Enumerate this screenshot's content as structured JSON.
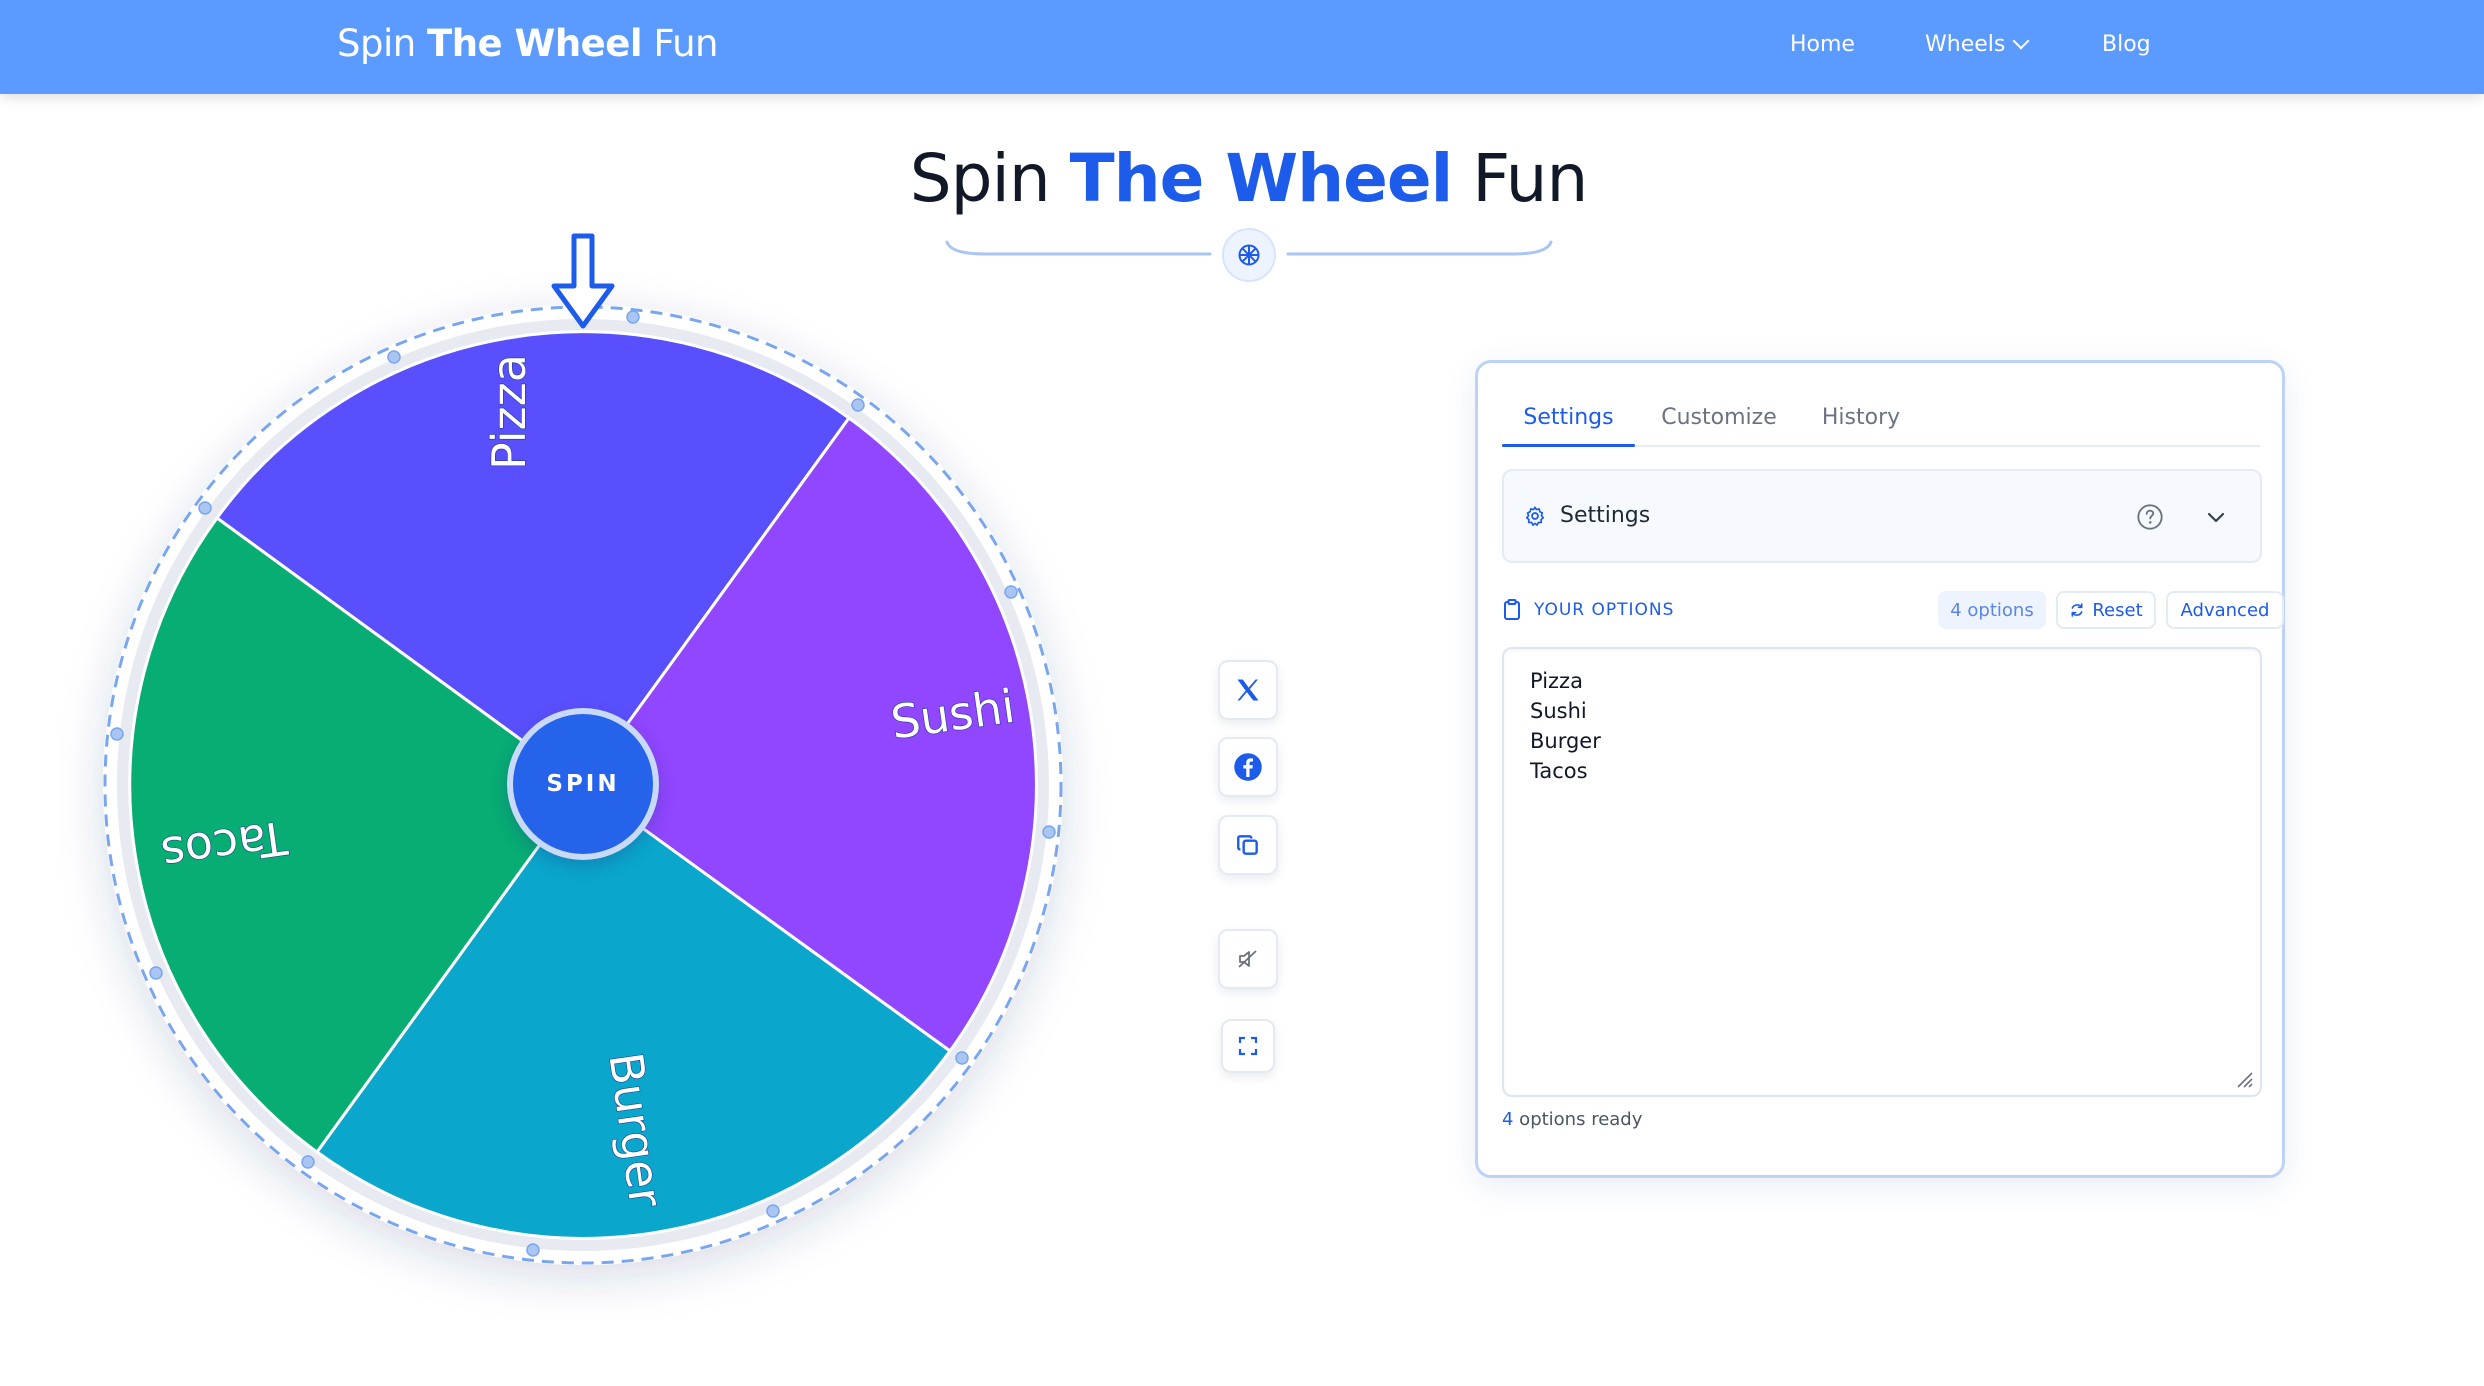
{
  "nav": {
    "brand_light": "Spin ",
    "brand_bold": "The Wheel",
    "brand_tail": " Fun",
    "links": {
      "home": "Home",
      "wheels": "Wheels",
      "blog": "Blog"
    }
  },
  "title": {
    "pre": "Spin ",
    "accent": "The Wheel",
    "post": " Fun"
  },
  "wheel": {
    "spin_label": "SPIN",
    "segments": [
      {
        "label": "Pizza",
        "color": "#5a4ffd"
      },
      {
        "label": "Sushi",
        "color": "#9146ff"
      },
      {
        "label": "Burger",
        "color": "#0aa6cc"
      },
      {
        "label": "Tacos",
        "color": "#07ad73"
      }
    ],
    "pointer_color": "#1d5bea"
  },
  "side_buttons": [
    "x-share",
    "facebook-share",
    "copy-link",
    "mute",
    "fullscreen"
  ],
  "panel": {
    "tabs": {
      "settings": "Settings",
      "customize": "Customize",
      "history": "History"
    },
    "settings_label": "Settings",
    "options_label": "YOUR OPTIONS",
    "count_pill": "4 options",
    "reset": "Reset",
    "advanced": "Advanced",
    "options": [
      "Pizza",
      "Sushi",
      "Burger",
      "Tacos"
    ],
    "ready_num": "4",
    "ready_text": " options ready"
  },
  "colors": {
    "nav": "#5b9bff",
    "accent": "#1d5bea"
  }
}
